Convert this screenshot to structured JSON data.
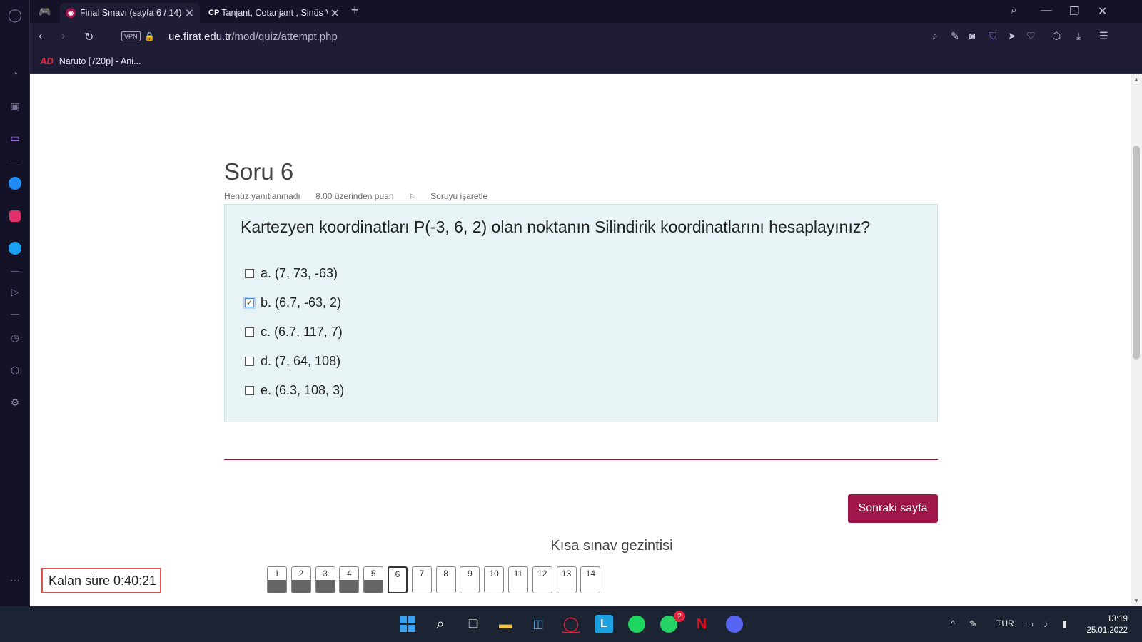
{
  "browser": {
    "tabs": [
      {
        "title": "Final Sınavı (sayfa 6 / 14)",
        "active": true
      },
      {
        "title": "Tanjant, Cotanjant , Sinüs V",
        "favicon_text": "CP",
        "active": false
      }
    ],
    "url_host": "ue.firat.edu.tr",
    "url_path": "/mod/quiz/attempt.php",
    "vpn_label": "VPN",
    "bookmark": {
      "label": "Naruto [720p] - Ani...",
      "icon_text": "AD"
    }
  },
  "question": {
    "title": "Soru 6",
    "status": "Henüz yanıtlanmadı",
    "points": "8.00 üzerinden puan",
    "flag_label": "Soruyu işaretle",
    "text": "Kartezyen koordinatları P(-3, 6, 2) olan noktanın Silindirik koordinatlarını hesaplayınız?",
    "options": [
      {
        "label": "a. (7, 73, -63)",
        "checked": false
      },
      {
        "label": "b. (6.7, -63, 2)",
        "checked": true
      },
      {
        "label": "c. (6.7, 117, 7)",
        "checked": false
      },
      {
        "label": "d. (7, 64, 108)",
        "checked": false
      },
      {
        "label": "e. (6.3, 108, 3)",
        "checked": false
      }
    ]
  },
  "next_button": "Sonraki sayfa",
  "nav_title": "Kısa sınav gezintisi",
  "timer": "Kalan süre 0:40:21",
  "quiz_nav": {
    "items": [
      "1",
      "2",
      "3",
      "4",
      "5",
      "6",
      "7",
      "8",
      "9",
      "10",
      "11",
      "12",
      "13",
      "14"
    ],
    "answered": [
      1,
      2,
      3,
      4,
      5
    ],
    "current": 6
  },
  "taskbar": {
    "language": "TUR",
    "time": "13:19",
    "date": "25.01.2022",
    "whatsapp_badge": "2"
  },
  "colors": {
    "accent": "#a0154a",
    "question_bg": "#e7f3f5",
    "browser_bg": "#141226"
  }
}
